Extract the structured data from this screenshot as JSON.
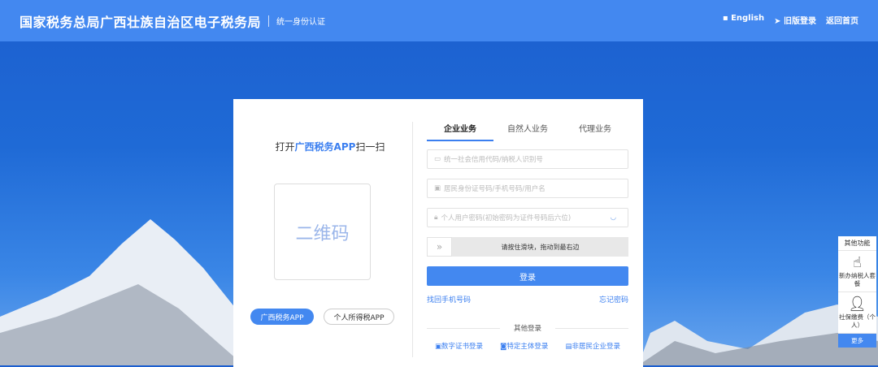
{
  "header": {
    "title": "国家税务总局广西壮族自治区电子税务局",
    "subtitle": "统一身份认证",
    "english": "English",
    "old_login": "旧版登录",
    "home": "返回首页"
  },
  "left": {
    "scan_prefix": "打开",
    "scan_app": "广西税务APP",
    "scan_suffix": "扫一扫",
    "qr_placeholder": "二维码",
    "app_buttons": [
      "广西税务APP",
      "个人所得税APP"
    ]
  },
  "tabs": [
    "企业业务",
    "自然人业务",
    "代理业务"
  ],
  "fields": {
    "credit_code": "统一社会信用代码/纳税人识别号",
    "account": "居民身份证号码/手机号码/用户名",
    "password": "个人用户密码(初始密码为证件号码后六位)"
  },
  "slider": {
    "text": "请按住滑块，拖动到最右边"
  },
  "login_label": "登录",
  "links": {
    "retrieve_phone": "找回手机号码",
    "forgot_password": "忘记密码"
  },
  "other_login": {
    "title": "其他登录",
    "items": [
      "数字证书登录",
      "特定主体登录",
      "非居民企业登录"
    ]
  },
  "side_panel": {
    "title": "其他功能",
    "items": [
      "新办纳税人套餐",
      "社保缴费（个人）"
    ],
    "more": "更多"
  }
}
